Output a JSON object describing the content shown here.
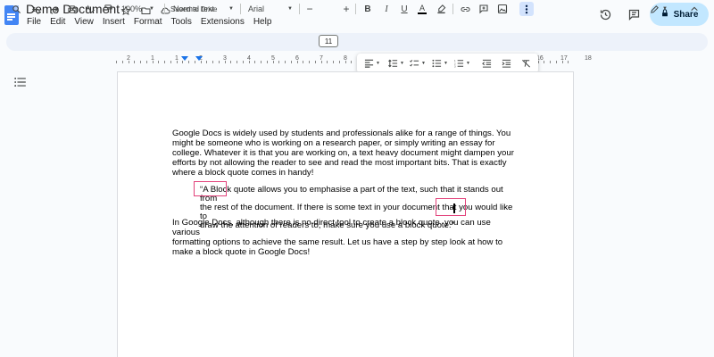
{
  "app": {
    "title": "Demo Document",
    "saved_status": "Saved to Drive",
    "share_label": "Share",
    "accent": "#1a73e8",
    "share_bg": "#c2e7ff",
    "highlight_color": "#e2417a"
  },
  "menu": [
    "File",
    "Edit",
    "View",
    "Insert",
    "Format",
    "Tools",
    "Extensions",
    "Help"
  ],
  "toolbar": {
    "zoom": "100%",
    "style": "Normal text",
    "font": "Arial",
    "font_size": "11",
    "icons": [
      "search-icon",
      "undo-icon",
      "redo-icon",
      "print-icon",
      "spellcheck-icon",
      "paint-format-icon",
      "bold-icon",
      "italic-icon",
      "underline-icon",
      "text-color-icon",
      "highlight-icon",
      "link-icon",
      "comment-icon",
      "image-icon",
      "more-icon",
      "edit-mode-icon",
      "collapse-icon"
    ]
  },
  "ruler": {
    "numbers": [
      "2",
      "1",
      "1",
      "2",
      "3",
      "4",
      "5",
      "6",
      "7",
      "8",
      "9",
      "10",
      "11",
      "12",
      "13",
      "14",
      "15",
      "16",
      "17",
      "18"
    ]
  },
  "document": {
    "paragraph1": [
      "Google Docs is widely used by students and professionals alike for a range of things. You",
      "might be someone who is working on a research paper, or simply writing an essay for",
      "college. Whatever it is that you are working on, a text heavy document might dampen your",
      "efforts by not allowing the reader to see and read the most important bits. That is exactly",
      "where a block quote comes in handy!"
    ],
    "quote": [
      "“A Block quote allows you to emphasise a part of the text, such that it stands out from",
      "the rest of the document. If there is some text in your document that you would like to",
      "draw the attention of readers to, make sure you use a block quote.”"
    ],
    "paragraph2": [
      "In Google Docs, although there is no direct tool to create a block quote, you can use various",
      "formatting options to achieve the same result. Let us have a step by step look at how to",
      "make a block quote in Google Docs!"
    ]
  }
}
